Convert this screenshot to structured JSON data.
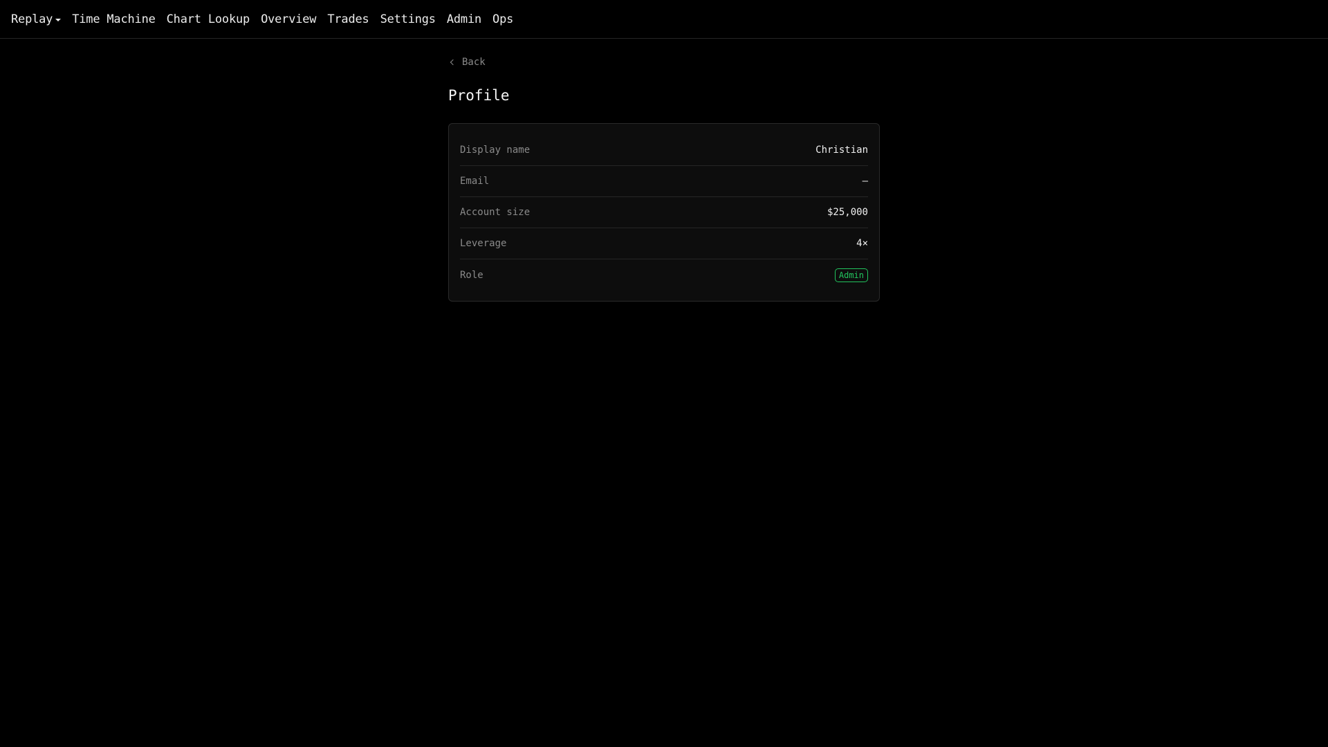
{
  "nav": {
    "items": [
      {
        "label": "Replay",
        "dropdown": true
      },
      {
        "label": "Time Machine"
      },
      {
        "label": "Chart Lookup"
      },
      {
        "label": "Overview"
      },
      {
        "label": "Trades"
      },
      {
        "label": "Settings"
      },
      {
        "label": "Admin"
      },
      {
        "label": "Ops"
      }
    ]
  },
  "back": {
    "label": "Back"
  },
  "page": {
    "title": "Profile"
  },
  "profile": {
    "rows": [
      {
        "label": "Display name",
        "value": "Christian"
      },
      {
        "label": "Email",
        "value": "—"
      },
      {
        "label": "Account size",
        "value": "$25,000"
      },
      {
        "label": "Leverage",
        "value": "4×"
      },
      {
        "label": "Role",
        "value": "Admin"
      }
    ]
  },
  "colors": {
    "background": "#000000",
    "accent_green": "#22c55e"
  }
}
